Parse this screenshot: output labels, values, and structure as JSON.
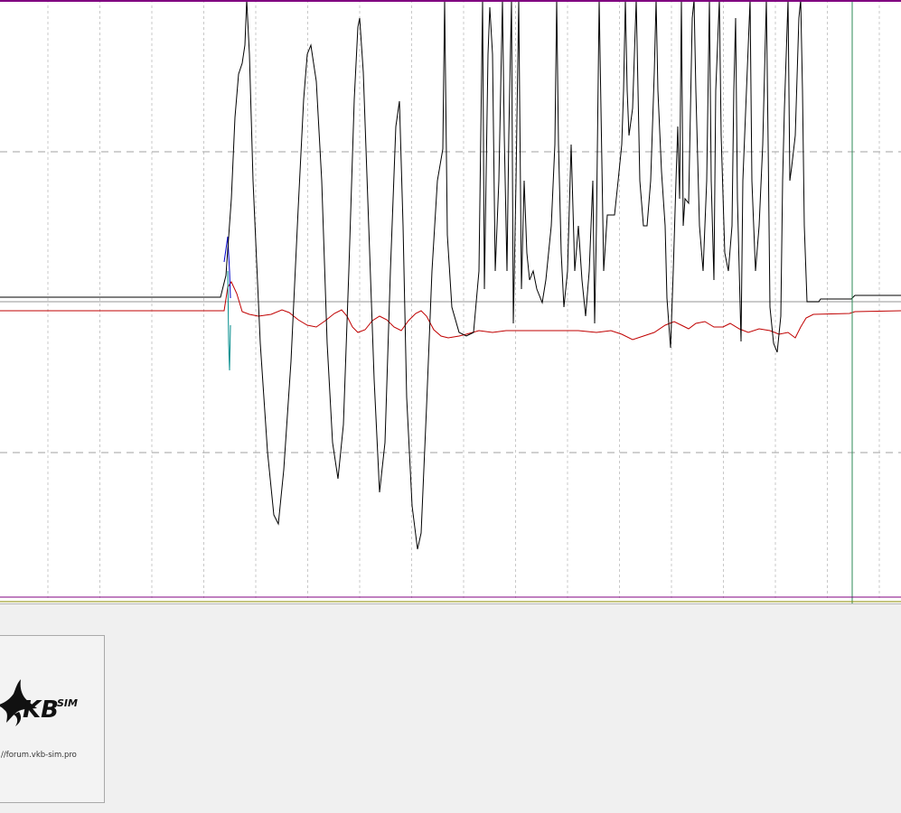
{
  "colors": {
    "background": "#ffffff",
    "grid_vertical": "#c8c8c8",
    "grid_horizontal": "#a0a0a0",
    "frame_top": "#800080",
    "frame_bottom": "#800080",
    "frame_bottom_olive": "#8b8b00",
    "center_line": "#b8b8b8",
    "cursor_line": "#2e8b57",
    "signal_black": "#000000",
    "signal_red": "#c00000",
    "signal_blue": "#0000cc",
    "signal_teal": "#008b8b",
    "panel": "#f0f0f0"
  },
  "logo": {
    "brand": "KB",
    "brand_super": "SIM",
    "url": "//forum.vkb-sim.pro",
    "icon": "eagle-icon"
  }
}
